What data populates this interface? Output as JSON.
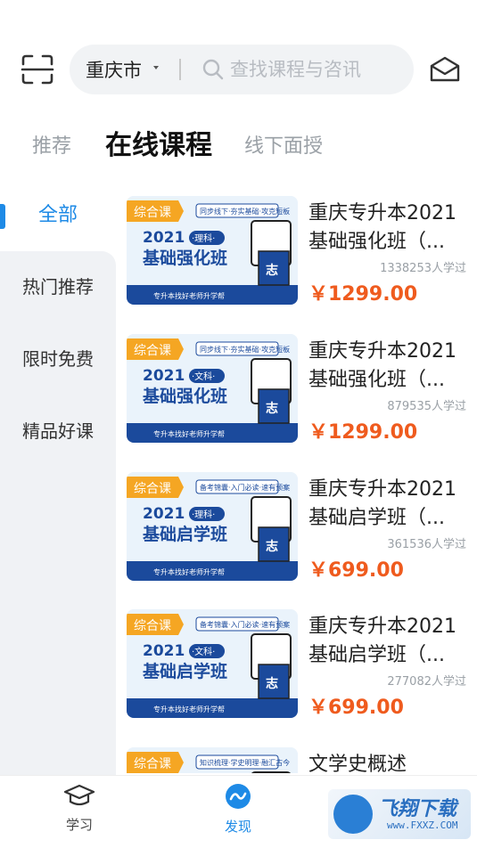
{
  "search": {
    "city": "重庆市",
    "placeholder": "查找课程与咨讯"
  },
  "tabs": [
    {
      "label": "推荐",
      "active": false
    },
    {
      "label": "在线课程",
      "active": true
    },
    {
      "label": "线下面授",
      "active": false
    }
  ],
  "sidebar": {
    "items": [
      {
        "label": "全部",
        "active": true
      },
      {
        "label": "热门推荐",
        "active": false
      },
      {
        "label": "限时免费",
        "active": false
      },
      {
        "label": "精品好课",
        "active": false
      }
    ]
  },
  "courses": [
    {
      "title_line1": "重庆专升本2021",
      "title_line2": "基础强化班（...",
      "learners": "1338253人学过",
      "price": "￥1299.00",
      "thumb": {
        "badge": "综合课",
        "year": "2021",
        "subject": "·理科·",
        "name": "基础强化班",
        "slogan": "同步线下·夯实基础·攻克短板",
        "footer": "专升本找好老师升学帮",
        "char": "志"
      }
    },
    {
      "title_line1": "重庆专升本2021",
      "title_line2": "基础强化班（...",
      "learners": "879535人学过",
      "price": "￥1299.00",
      "thumb": {
        "badge": "综合课",
        "year": "2021",
        "subject": "·文科·",
        "name": "基础强化班",
        "slogan": "同步线下·夯实基础·攻克短板",
        "footer": "专升本找好老师升学帮",
        "char": "志"
      }
    },
    {
      "title_line1": "重庆专升本2021",
      "title_line2": "基础启学班（...",
      "learners": "361536人学过",
      "price": "￥699.00",
      "thumb": {
        "badge": "综合课",
        "year": "2021",
        "subject": "·理科·",
        "name": "基础启学班",
        "slogan": "备考锦囊·入门必读·速有预案",
        "footer": "专升本找好老师升学帮",
        "char": "志"
      }
    },
    {
      "title_line1": "重庆专升本2021",
      "title_line2": "基础启学班（...",
      "learners": "277082人学过",
      "price": "￥699.00",
      "thumb": {
        "badge": "综合课",
        "year": "2021",
        "subject": "·文科·",
        "name": "基础启学班",
        "slogan": "备考锦囊·入门必读·速有预案",
        "footer": "专升本找好老师升学帮",
        "char": "志"
      }
    },
    {
      "title_line1": "文学史概述",
      "title_line2": "",
      "learners": "",
      "price": "",
      "thumb": {
        "badge": "综合课",
        "year": "",
        "subject": "",
        "name": "",
        "slogan": "知识梳理·学史明理·融汇古今",
        "footer": "",
        "char": ""
      }
    }
  ],
  "bottom_nav": [
    {
      "label": "学习",
      "icon": "graduation-cap-icon",
      "active": false
    },
    {
      "label": "发现",
      "icon": "discover-icon",
      "active": true
    }
  ],
  "watermark": {
    "text": "飞翔下载",
    "url": "www.FXXZ.COM"
  },
  "colors": {
    "accent": "#1e8ae6",
    "price": "#ef5b1e",
    "badge": "#f5a623",
    "thumb_navy": "#1b4a9c"
  }
}
